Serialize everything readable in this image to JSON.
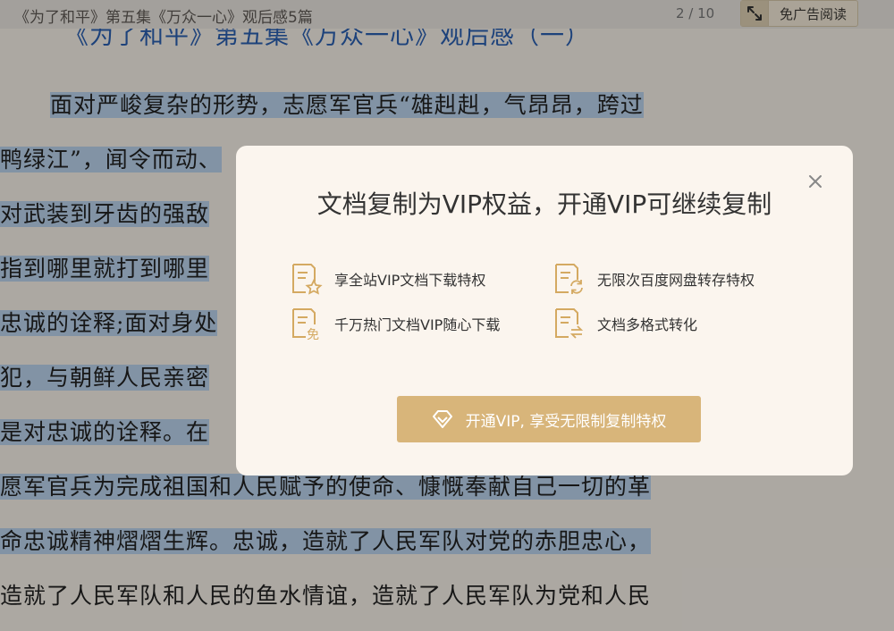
{
  "header": {
    "doc_title": "《为了和平》第五集《万众一心》观后感5篇",
    "page_indicator": "2 / 10",
    "adfree_button_label": "免广告阅读",
    "adfree_icon": "expand-arrows-icon"
  },
  "document": {
    "heading_partial": "《为了和平》第五集《万众一心》观后感（一）",
    "lines": [
      "面对严峻复杂的形势，志愿军官兵“雄赳赳，气昂昂，跨过",
      "鸭绿江”，闻令而动、",
      "对武装到牙齿的强敌",
      "指到哪里就打到哪里",
      "忠诚的诠释;面对身处",
      "犯，与朝鲜人民亲密",
      "是对忠诚的诠释。在",
      "愿军官兵为完成祖国和人民赋予的使命、慷慨奉献自己一切的革",
      "命忠诚精神熠熠生辉。忠诚，造就了人民军队对党的赤胆忠心，",
      "造就了人民军队和人民的鱼水情谊，造就了人民军队为党和人民"
    ]
  },
  "modal": {
    "title": "文档复制为VIP权益，开通VIP可继续复制",
    "close_icon": "close-icon",
    "benefits": [
      {
        "label": "享全站VIP文档下载特权",
        "icon": "doc-star-icon"
      },
      {
        "label": "无限次百度网盘转存特权",
        "icon": "doc-refresh-icon"
      },
      {
        "label": "千万热门文档VIP随心下载",
        "icon": "doc-free-icon"
      },
      {
        "label": "文档多格式转化",
        "icon": "doc-convert-icon"
      }
    ],
    "cta_label": "开通VIP, 享受无限制复制特权",
    "cta_icon": "diamond-icon",
    "free_badge": "免"
  },
  "colors": {
    "accent_gold": "#d8b57a",
    "highlight_blue": "#bad3ec",
    "heading_blue": "#2a5fb0"
  }
}
